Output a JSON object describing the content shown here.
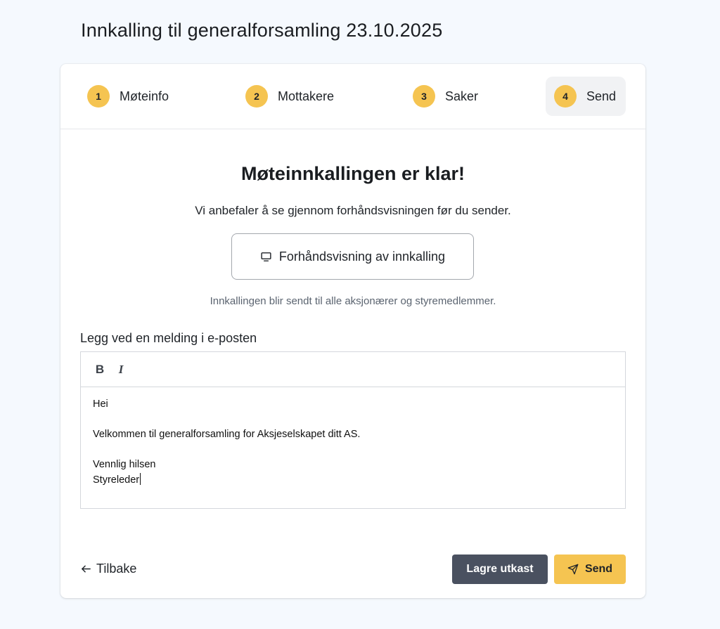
{
  "page": {
    "title": "Innkalling til generalforsamling 23.10.2025"
  },
  "stepper": {
    "steps": [
      {
        "number": "1",
        "label": "Møteinfo",
        "active": false
      },
      {
        "number": "2",
        "label": "Mottakere",
        "active": false
      },
      {
        "number": "3",
        "label": "Saker",
        "active": false
      },
      {
        "number": "4",
        "label": "Send",
        "active": true
      }
    ]
  },
  "main": {
    "heading": "Møteinnkallingen er klar!",
    "subheading": "Vi anbefaler å se gjennom forhåndsvisningen før du sender.",
    "preview_button_label": "Forhåndsvisning av innkalling",
    "preview_button_icon": "monitor-icon",
    "recipients_note": "Innkallingen blir sendt til alle aksjonærer og styremedlemmer."
  },
  "message": {
    "label": "Legg ved en melding i e-posten",
    "toolbar": {
      "bold_label": "B",
      "italic_label": "I"
    },
    "lines": [
      "Hei",
      "",
      "Velkommen til generalforsamling for Aksjeselskapet ditt AS.",
      "",
      "Vennlig hilsen",
      "Styreleder"
    ]
  },
  "footer": {
    "back_label": "Tilbake",
    "back_icon": "arrow-left-icon",
    "save_draft_label": "Lagre utkast",
    "send_label": "Send",
    "send_icon": "paper-plane-icon"
  },
  "colors": {
    "accent": "#f5c451",
    "secondary_button": "#4a5160",
    "background": "#f5f9fe"
  }
}
